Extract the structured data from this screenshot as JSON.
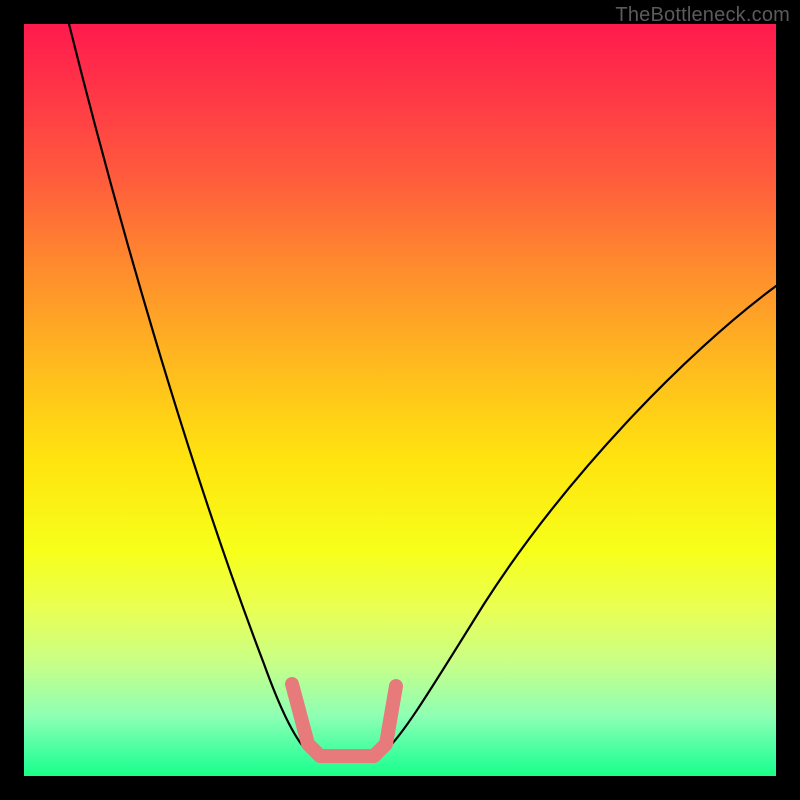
{
  "watermark": {
    "text": "TheBottleneck.com"
  },
  "chart_data": {
    "type": "line",
    "title": "",
    "xlabel": "",
    "ylabel": "",
    "xlim": [
      0,
      100
    ],
    "ylim": [
      0,
      100
    ],
    "grid": false,
    "series": [
      {
        "name": "left-curve",
        "x": [
          6,
          10,
          14,
          18,
          22,
          26,
          30,
          32,
          34,
          35.5,
          37
        ],
        "y": [
          100,
          86,
          71,
          56,
          42,
          28,
          15,
          10,
          6,
          4,
          3
        ]
      },
      {
        "name": "right-curve",
        "x": [
          48,
          50,
          54,
          58,
          64,
          72,
          80,
          88,
          96,
          100
        ],
        "y": [
          3,
          4,
          8,
          14,
          23,
          34,
          44,
          53,
          61,
          65
        ]
      },
      {
        "name": "flat-bottom",
        "x": [
          37,
          40,
          44,
          48
        ],
        "y": [
          3,
          2.8,
          2.8,
          3
        ]
      }
    ],
    "annotations": [
      {
        "name": "highlight-marker",
        "shape": "U",
        "x_range": [
          35,
          49
        ],
        "y_range": [
          2,
          12
        ]
      }
    ],
    "background_gradient": {
      "stops": [
        {
          "pos": 0.0,
          "color": "#ff1a4d"
        },
        {
          "pos": 0.45,
          "color": "#ffe40f"
        },
        {
          "pos": 0.8,
          "color": "#e8ff55"
        },
        {
          "pos": 1.0,
          "color": "#1aff88"
        }
      ]
    }
  }
}
